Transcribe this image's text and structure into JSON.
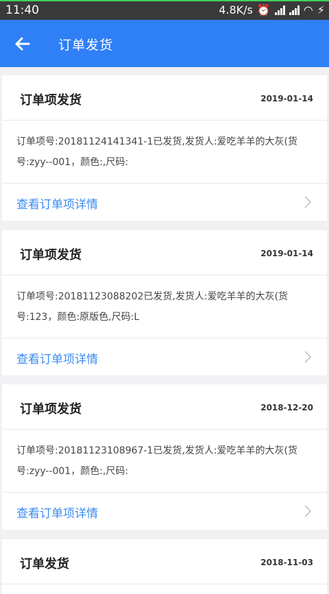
{
  "status_bar": {
    "time": "11:40",
    "speed": "4.8K/s"
  },
  "header": {
    "title": "订单发货"
  },
  "colors": {
    "accent": "#2f7ff6",
    "link": "#3a8cf0"
  },
  "cards": [
    {
      "title": "订单项发货",
      "date": "2019-01-14",
      "body": "订单项号:20181124141341-1已发货,发货人:爱吃羊羊的大灰(货号:zyy--001，颜色:,尺码:",
      "link": "查看订单项详情"
    },
    {
      "title": "订单项发货",
      "date": "2019-01-14",
      "body": "订单项号:20181123088202已发货,发货人:爱吃羊羊的大灰(货号:123，颜色:原版色,尺码:L",
      "link": "查看订单项详情"
    },
    {
      "title": "订单项发货",
      "date": "2018-12-20",
      "body": "订单项号:20181123108967-1已发货,发货人:爱吃羊羊的大灰(货号:zyy--001，颜色:,尺码:",
      "link": "查看订单项详情"
    },
    {
      "title": "订单发货",
      "date": "2018-11-03"
    }
  ]
}
